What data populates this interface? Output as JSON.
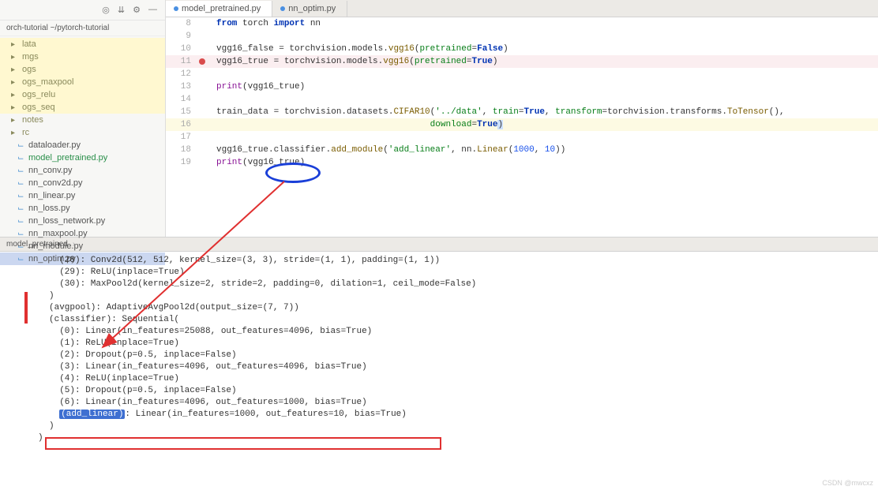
{
  "breadcrumb": "orch-tutorial  ~/pytorch-tutorial",
  "sidebar": {
    "folders": [
      "lata",
      "mgs",
      "ogs",
      "ogs_maxpool",
      "ogs_relu",
      "ogs_seq",
      "notes",
      "rc"
    ],
    "files": [
      {
        "name": "dataloader.py",
        "sel": false,
        "active": false
      },
      {
        "name": "model_pretrained.py",
        "sel": false,
        "active": true
      },
      {
        "name": "nn_conv.py",
        "sel": false,
        "active": false
      },
      {
        "name": "nn_conv2d.py",
        "sel": false,
        "active": false
      },
      {
        "name": "nn_linear.py",
        "sel": false,
        "active": false
      },
      {
        "name": "nn_loss.py",
        "sel": false,
        "active": false
      },
      {
        "name": "nn_loss_network.py",
        "sel": false,
        "active": false
      },
      {
        "name": "nn_maxpool.py",
        "sel": false,
        "active": false
      },
      {
        "name": "nn_module.py",
        "sel": false,
        "active": false
      },
      {
        "name": "nn_optim.py",
        "sel": true,
        "active": false
      }
    ]
  },
  "tabs": [
    {
      "label": "model_pretrained.py",
      "active": true
    },
    {
      "label": "nn_optim.py",
      "active": false
    }
  ],
  "output_tab": "model_pretrained",
  "code": {
    "l8": {
      "n": "8",
      "pre": "from",
      "mid": " torch ",
      "post": "import",
      "tail": " nn"
    },
    "l9": {
      "n": "9"
    },
    "l10": {
      "n": "10",
      "a": "vgg16_false = torchvision.models.",
      "b": "vgg16",
      "c": "(",
      "d": "pretrained",
      "e": "=",
      "f": "False",
      "g": ")"
    },
    "l11": {
      "n": "11",
      "a": "vgg16_true = torchvision.models.",
      "b": "vgg16",
      "c": "(",
      "d": "pretrained",
      "e": "=",
      "f": "True",
      "g": ")"
    },
    "l12": {
      "n": "12"
    },
    "l13": {
      "n": "13",
      "a": "print",
      "b": "(vgg16_true)"
    },
    "l14": {
      "n": "14"
    },
    "l15": {
      "n": "15",
      "a": "train_data = torchvision.datasets.",
      "b": "CIFAR10",
      "c": "(",
      "d": "'../data'",
      "e": ", ",
      "f": "train",
      "g": "=",
      "h": "True",
      "i": ", ",
      "j": "transform",
      "k": "=torchvision.transforms.",
      "l": "ToTensor",
      "m": "(),"
    },
    "l16": {
      "n": "16",
      "a": "                                         ",
      "b": "download",
      "c": "=",
      "d": "True",
      "e": ")"
    },
    "l17": {
      "n": "17"
    },
    "l18": {
      "n": "18",
      "a": "vgg16_true.classifier.",
      "b": "add_module",
      "c": "(",
      "d": "'add_linear'",
      "e": ", nn.",
      "f": "Linear",
      "g": "(",
      "h": "1000",
      "i": ", ",
      "j": "10",
      "k": "))"
    },
    "l19": {
      "n": "19",
      "a": "print",
      "b": "(vgg16_true)"
    }
  },
  "output": [
    "  (28): Conv2d(512, 512, kernel_size=(3, 3), stride=(1, 1), padding=(1, 1))",
    "  (29): ReLU(inplace=True)",
    "  (30): MaxPool2d(kernel_size=2, stride=2, padding=0, dilation=1, ceil_mode=False)",
    ")",
    "(avgpool): AdaptiveAvgPool2d(output_size=(7, 7))",
    "(classifier): Sequential(",
    "  (0): Linear(in_features=25088, out_features=4096, bias=True)",
    "  (1): ReLU(inplace=True)",
    "  (2): Dropout(p=0.5, inplace=False)",
    "  (3): Linear(in_features=4096, out_features=4096, bias=True)",
    "  (4): ReLU(inplace=True)",
    "  (5): Dropout(p=0.5, inplace=False)",
    "  (6): Linear(in_features=4096, out_features=1000, bias=True)",
    ": Linear(in_features=1000, out_features=10, bias=True)",
    ")"
  ],
  "sel_label": "(add_linear)",
  "close_paren": ")",
  "watermark": "CSDN @mwcxz"
}
